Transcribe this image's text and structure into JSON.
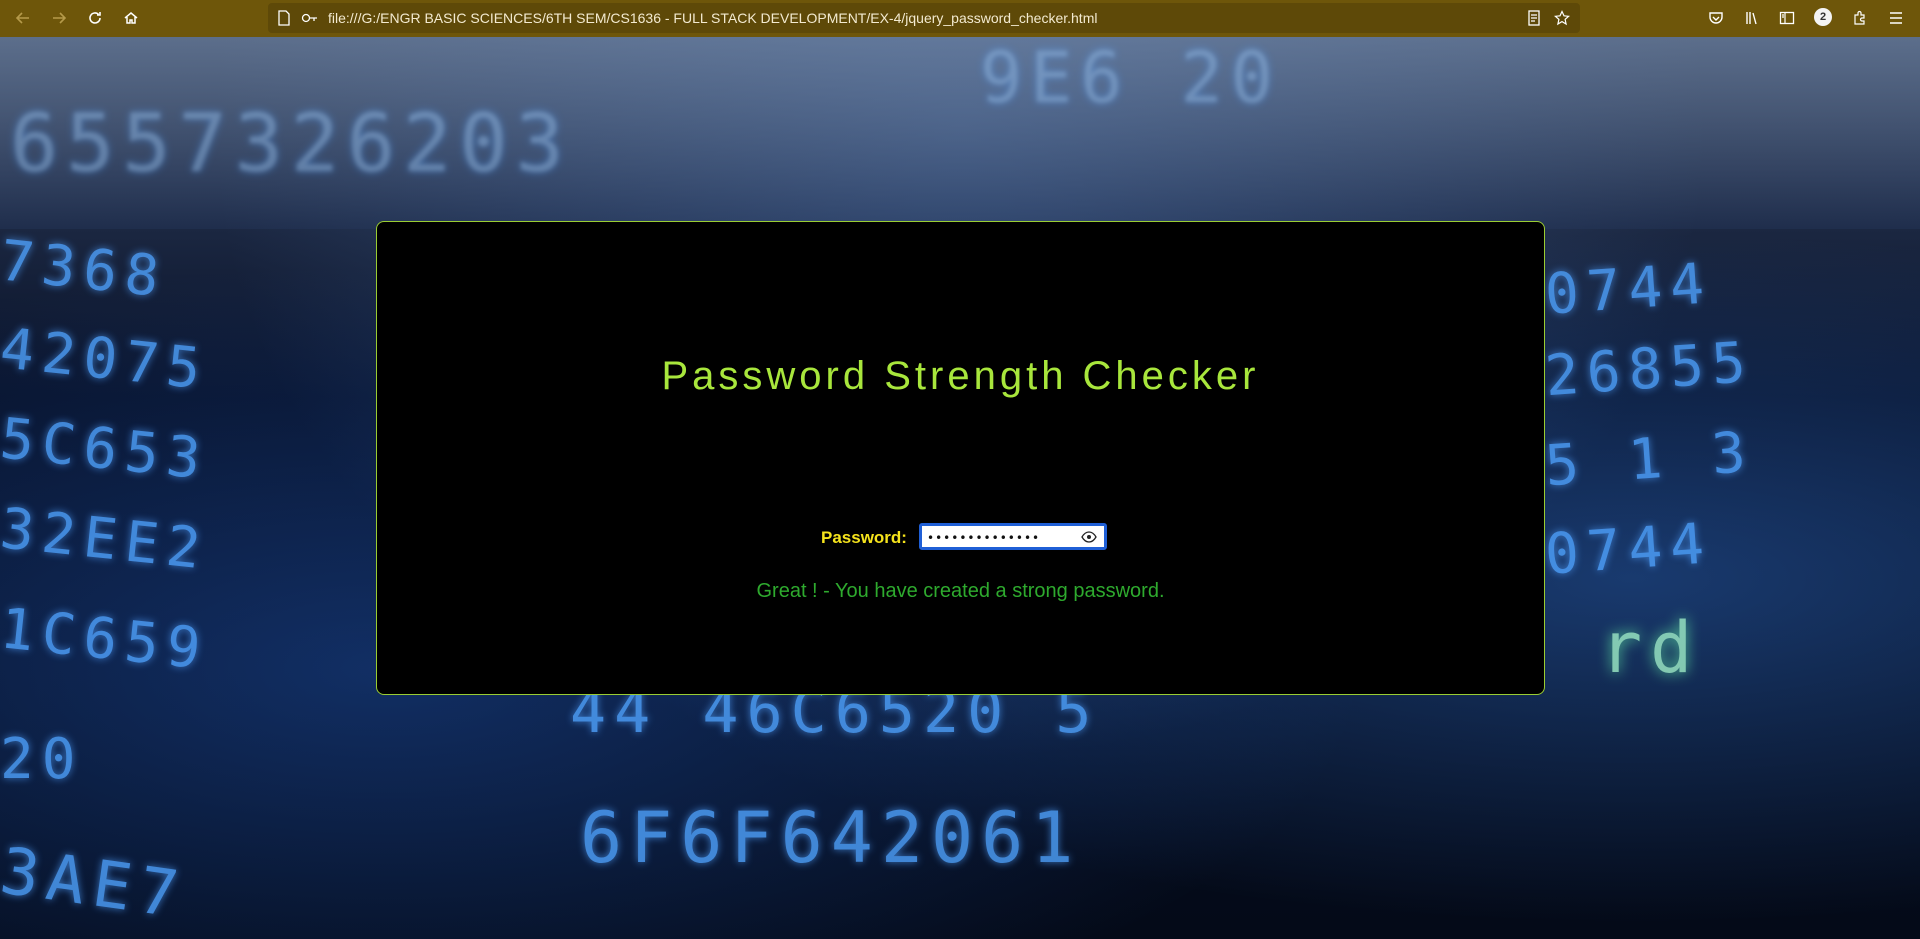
{
  "browser": {
    "url": "file:///G:/ENGR BASIC SCIENCES/6TH SEM/CS1636 - FULL STACK DEVELOPMENT/EX-4/jquery_password_checker.html",
    "badge_count": "2",
    "icons": [
      "back-icon",
      "forward-icon",
      "reload-icon",
      "home-icon",
      "page-icon",
      "permissions-icon",
      "reader-view-icon",
      "bookmark-star-icon",
      "pocket-icon",
      "library-icon",
      "sidebar-icon",
      "extensions-icon",
      "menu-icon"
    ]
  },
  "checker": {
    "title": "Password Strength Checker",
    "password_label": "Password:",
    "password_value": "••••••••••••••",
    "strength_message": "Great ! - You have created a strong password.",
    "colors": {
      "title": "#a8e63c",
      "label": "#f5e31c",
      "message": "#2eaa2e",
      "card_border": "#9acd32"
    }
  }
}
